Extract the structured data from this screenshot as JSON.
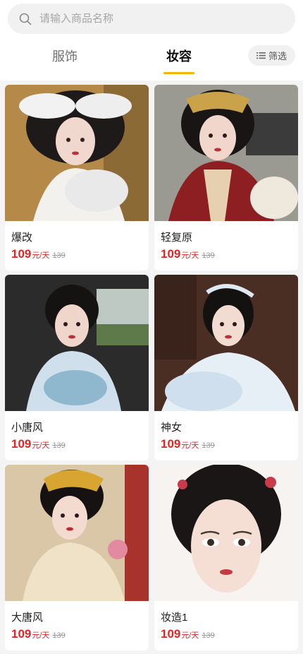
{
  "search": {
    "placeholder": "请输入商品名称",
    "icon": "search-icon"
  },
  "tabs": [
    {
      "label": "服饰",
      "active": false
    },
    {
      "label": "妆容",
      "active": true
    }
  ],
  "filter": {
    "label": "筛选",
    "icon": "filter-list-icon"
  },
  "colors": {
    "accent": "#f4b400",
    "price": "#e62224"
  },
  "products": [
    {
      "name": "爆改",
      "price": "109",
      "unit": "元/天",
      "original_price": "139"
    },
    {
      "name": "轻复原",
      "price": "109",
      "unit": "元/天",
      "original_price": "139"
    },
    {
      "name": "小唐风",
      "price": "109",
      "unit": "元/天",
      "original_price": "139"
    },
    {
      "name": "神女",
      "price": "109",
      "unit": "元/天",
      "original_price": "139"
    },
    {
      "name": "大唐风",
      "price": "109",
      "unit": "元/天",
      "original_price": "139"
    },
    {
      "name": "妆造1",
      "price": "109",
      "unit": "元/天",
      "original_price": "139"
    }
  ]
}
